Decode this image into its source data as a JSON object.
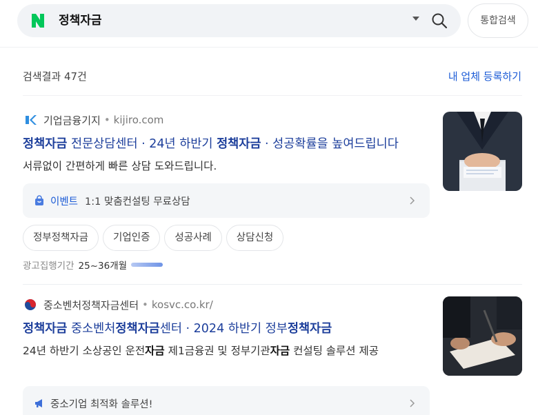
{
  "header": {
    "logo": "N",
    "query": "정책자금",
    "tab_all_label": "통합검색"
  },
  "results": {
    "count_label": "검색결과 47건",
    "register_link": "내 업체 등록하기"
  },
  "ads": [
    {
      "site_name": "기업금융기지",
      "domain": "kijiro.com",
      "favicon_icon": "ks-logo-icon",
      "title_parts": [
        {
          "text": "정책자금",
          "bold": true
        },
        {
          "text": " 전문상담센터 · 24년 하반기 ",
          "bold": false
        },
        {
          "text": "정책자금",
          "bold": true
        },
        {
          "text": " · 성공확률을 높여드립니다",
          "bold": false
        }
      ],
      "description": "서류없이 간편하게 빠른 상담 도와드립니다.",
      "event": {
        "label": "이벤트",
        "text": "1:1 맞춤컨설팅 무료상담",
        "icon": "shopping-bag-icon"
      },
      "chips": [
        "정부정책자금",
        "기업인증",
        "성공사례",
        "상담신청"
      ],
      "period_label": "광고집행기간",
      "period_value": "25~36개월",
      "period_fill": 0.7,
      "thumb_icon": "business-hands-photo"
    },
    {
      "site_name": "중소벤처정책자금센터",
      "domain": "kosvc.co.kr/",
      "favicon_icon": "taegeuk-icon",
      "title_parts": [
        {
          "text": "정책자금",
          "bold": true
        },
        {
          "text": " 중소벤처",
          "bold": false
        },
        {
          "text": "정책자금",
          "bold": true
        },
        {
          "text": "센터 · 2024 하반기 정부",
          "bold": false
        },
        {
          "text": "정책자금",
          "bold": true
        }
      ],
      "description_parts": [
        {
          "text": "24년 하반기 소상공인 운전",
          "bold": false
        },
        {
          "text": "자금",
          "bold": true
        },
        {
          "text": " 제1금융권 및 정부기관",
          "bold": false
        },
        {
          "text": "자금",
          "bold": true
        },
        {
          "text": " 컨설팅 솔루션 제공",
          "bold": false
        }
      ],
      "event": {
        "text": "중소기업 최적화 솔루션!",
        "icon": "megaphone-icon"
      },
      "thumb_icon": "contract-signing-photo"
    }
  ],
  "colors": {
    "naver_green": "#03c75a",
    "link_blue": "#1b5bd6",
    "title_blue": "#1c3e9b"
  }
}
